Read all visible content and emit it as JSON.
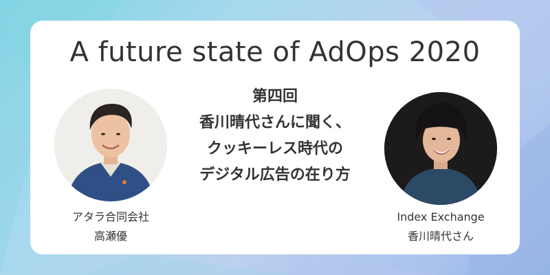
{
  "banner": {
    "title": "A future state of AdOps 2020",
    "episode_lines": [
      "第四回",
      "香川晴代さんに聞く、",
      "クッキーレス時代の",
      "デジタル広告の在り方"
    ]
  },
  "speakers": [
    {
      "company": "アタラ合同会社",
      "name": "高瀬優"
    },
    {
      "company": "Index Exchange",
      "name": "香川晴代さん"
    }
  ]
}
